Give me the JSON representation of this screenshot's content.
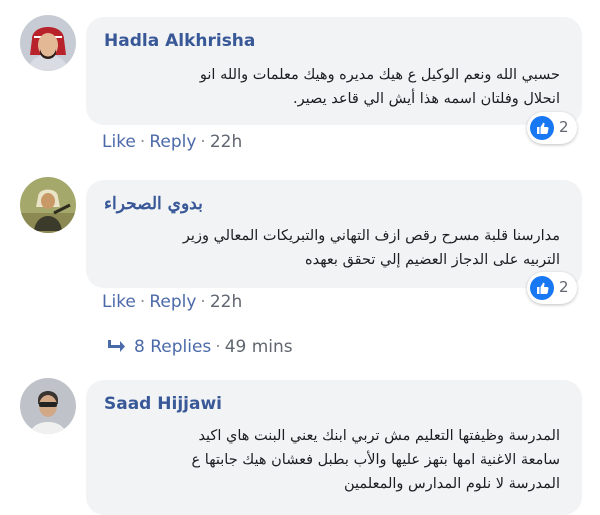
{
  "comments": [
    {
      "author": "Hadla Alkhrisha",
      "text_lines": [
        "حسبي الله ونعم الوكيل ع هيك مديره وهيك معلمات والله انو",
        "انحلال وفلتان اسمه هذا أيش الي قاعد يصير."
      ],
      "actions": {
        "like": "Like",
        "reply": "Reply",
        "time": "22h"
      },
      "reaction_count": "2"
    },
    {
      "author": "بدوي الصحراء",
      "text_lines": [
        "مدارسنا قلبة مسرح رقص ازف التهاني والتبريكات المعالي وزير",
        "التربيه على الدجاز العضيم إلي تحقق بعهده"
      ],
      "actions": {
        "like": "Like",
        "reply": "Reply",
        "time": "22h"
      },
      "reaction_count": "2"
    },
    {
      "author": "Saad Hijjawi",
      "text_lines": [
        "المدرسة وظيفتها التعليم مش تربي ابنك يعني البنت هاي اكيد",
        "سامعة الاغنية امها بتهز عليها والأب بطبل فعشان هيك جابتها ع",
        "المدرسة لا نلوم المدارس والمعلمين"
      ]
    }
  ],
  "replies_link": {
    "label": "8 Replies",
    "time": "49 mins"
  },
  "colors": {
    "author": "#385898",
    "link": "#4b6aa8",
    "bubble": "#f2f3f5",
    "like": "#1877f2"
  }
}
